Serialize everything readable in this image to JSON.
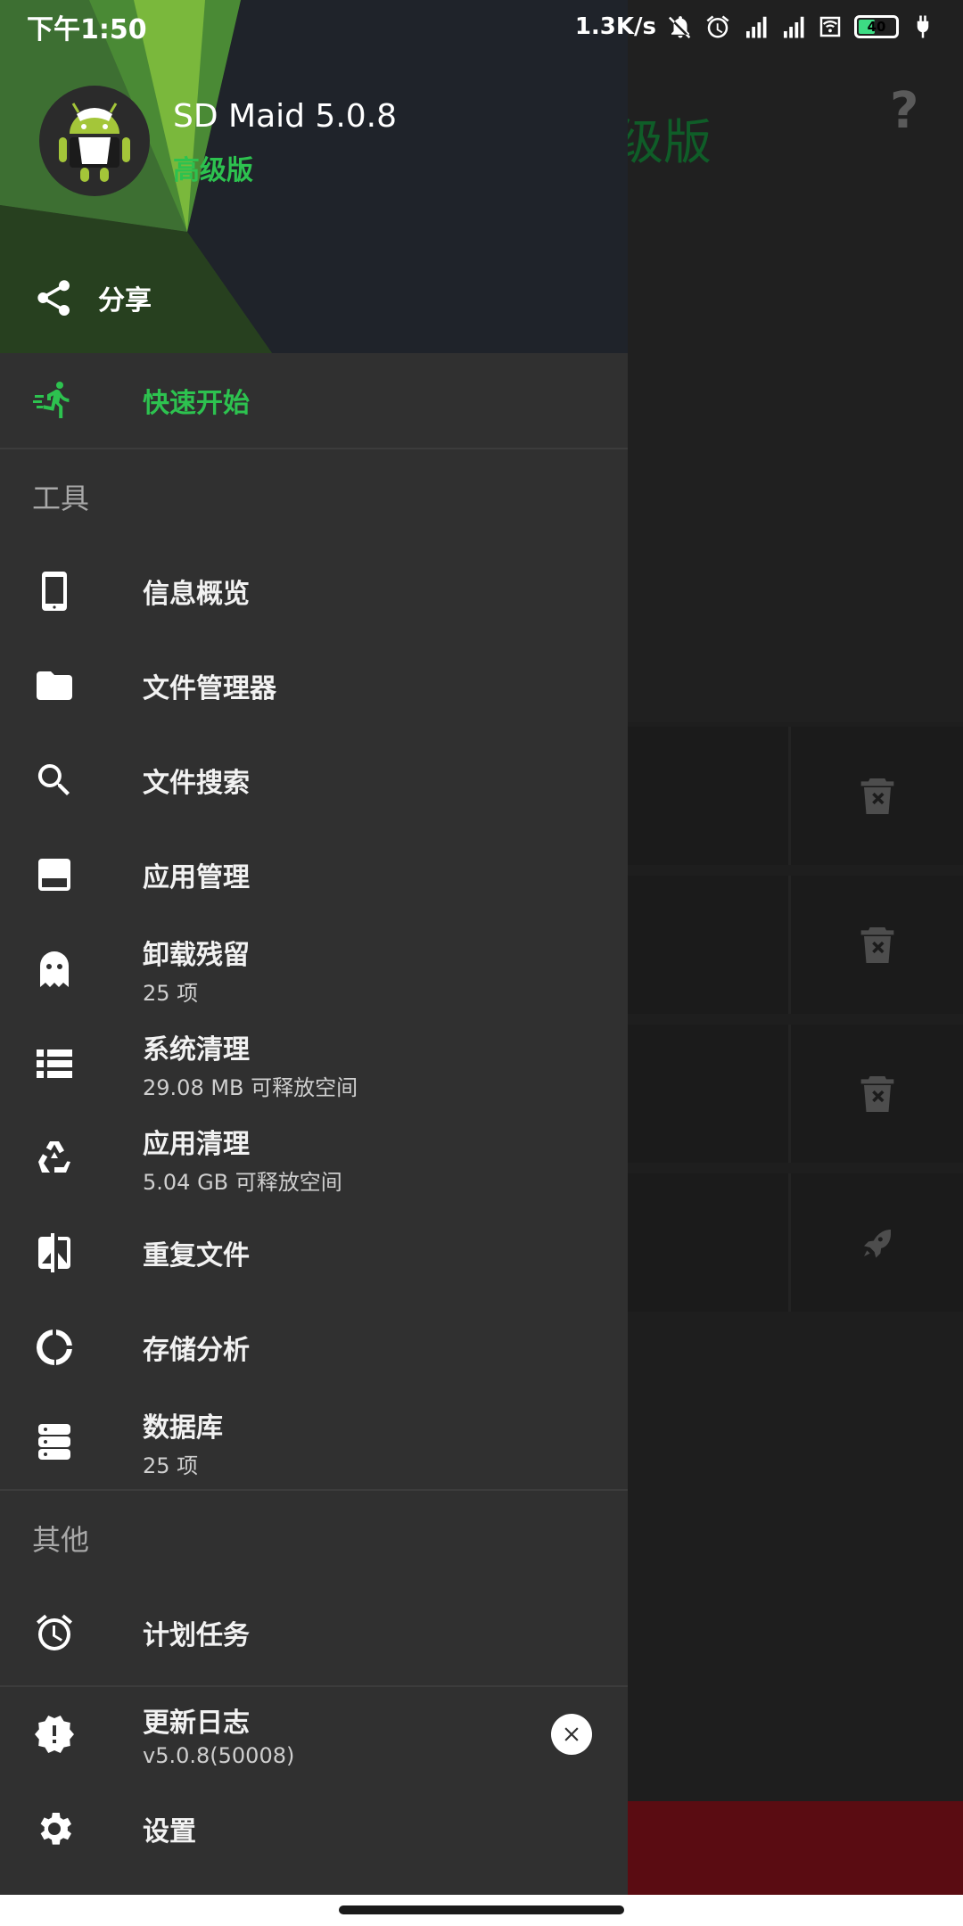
{
  "status_bar": {
    "time": "下午1:50",
    "speed": "1.3K/s",
    "battery": "40"
  },
  "background": {
    "title_fragment": "级版",
    "help": "?"
  },
  "drawer": {
    "app_name": "SD Maid 5.0.8",
    "app_tier": "高级版",
    "share_label": "分享",
    "quick_start": "快速开始",
    "tools_section": "工具",
    "tools": [
      {
        "label": "信息概览",
        "sub": ""
      },
      {
        "label": "文件管理器",
        "sub": ""
      },
      {
        "label": "文件搜索",
        "sub": ""
      },
      {
        "label": "应用管理",
        "sub": ""
      },
      {
        "label": "卸载残留",
        "sub": "25 项"
      },
      {
        "label": "系统清理",
        "sub": "29.08 MB 可释放空间"
      },
      {
        "label": "应用清理",
        "sub": "5.04 GB 可释放空间"
      },
      {
        "label": "重复文件",
        "sub": ""
      },
      {
        "label": "存储分析",
        "sub": ""
      },
      {
        "label": "数据库",
        "sub": "25 项"
      }
    ],
    "other_section": "其他",
    "scheduler": "计划任务",
    "changelog": {
      "label": "更新日志",
      "sub": "v5.0.8(50008)"
    },
    "settings": "设置"
  },
  "colors": {
    "accent": "#2dc24f",
    "drawer_bg": "#303030",
    "header_bg": "#1f232a",
    "bottom_bar": "#5a0c12"
  }
}
